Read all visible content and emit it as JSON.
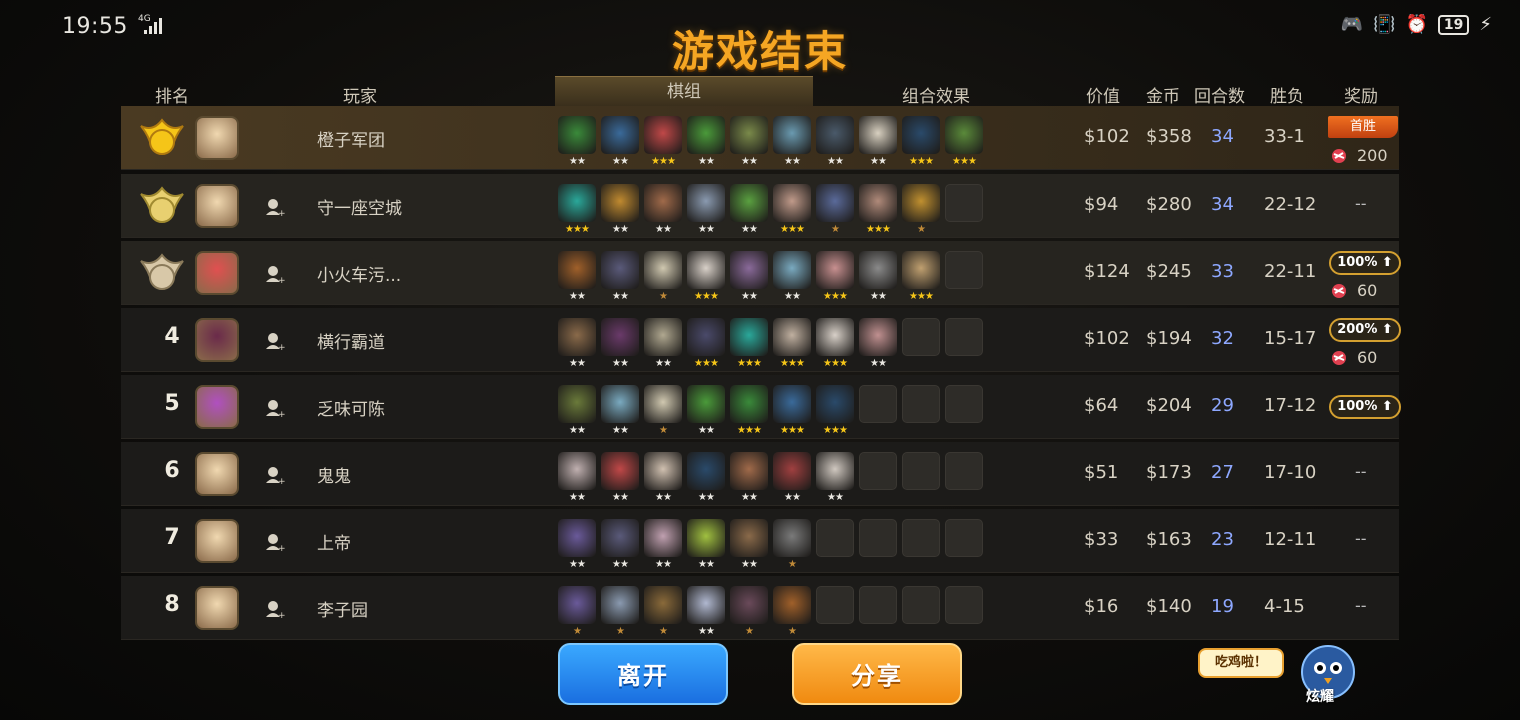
{
  "status_bar": {
    "time": "19:55",
    "network": "4G",
    "battery": "19"
  },
  "title": "游戏结束",
  "headers": {
    "rank": "排名",
    "player": "玩家",
    "lineup": "棋组",
    "synergy": "组合效果",
    "value": "价值",
    "gold": "金币",
    "rounds": "回合数",
    "winloss": "胜负",
    "reward": "奖励"
  },
  "rows": [
    {
      "rank": "1",
      "name": "橙子军团",
      "value": "$102",
      "gold": "$358",
      "rounds": "34",
      "winloss": "33-1",
      "reward_badge": "首胜",
      "reward_amount": "200",
      "units": [
        [
          "#3a8a3a",
          2
        ],
        [
          "#3a6a9a",
          2
        ],
        [
          "#c04848",
          3
        ],
        [
          "#4a9a3a",
          2
        ],
        [
          "#7a8a4a",
          2
        ],
        [
          "#6a9ab0",
          2
        ],
        [
          "#4a5a6a",
          2
        ],
        [
          "#d8d0c0",
          2
        ],
        [
          "#2a4a6a",
          3
        ],
        [
          "#5a8a3a",
          3
        ]
      ]
    },
    {
      "rank": "2",
      "name": "守一座空城",
      "value": "$94",
      "gold": "$280",
      "rounds": "34",
      "winloss": "22-12",
      "reward_text": "--",
      "units": [
        [
          "#2aa89a",
          3
        ],
        [
          "#c08a30",
          2
        ],
        [
          "#a06a4a",
          2
        ],
        [
          "#8a9ab0",
          2
        ],
        [
          "#5aa040",
          2
        ],
        [
          "#c09a8a",
          3
        ],
        [
          "#5a6a9a",
          1
        ],
        [
          "#b08a7a",
          3
        ],
        [
          "#c09030",
          1
        ],
        [
          null,
          0
        ]
      ]
    },
    {
      "rank": "3",
      "name": "小火车污...",
      "value": "$124",
      "gold": "$245",
      "rounds": "33",
      "winloss": "22-11",
      "reward_badge": "100%",
      "reward_amount": "60",
      "units": [
        [
          "#a0602a",
          2
        ],
        [
          "#5a5a7a",
          2
        ],
        [
          "#d0c8b0",
          1
        ],
        [
          "#d8d0c8",
          3
        ],
        [
          "#8a6a9a",
          2
        ],
        [
          "#7aaac0",
          2
        ],
        [
          "#c89090",
          3
        ],
        [
          "#8a8a8a",
          2
        ],
        [
          "#c0a070",
          3
        ],
        [
          null,
          0
        ]
      ]
    },
    {
      "rank": "4",
      "name": "横行霸道",
      "value": "$102",
      "gold": "$194",
      "rounds": "32",
      "winloss": "15-17",
      "reward_badge": "200%",
      "reward_amount": "60",
      "units": [
        [
          "#8a6a4a",
          2
        ],
        [
          "#6a3a6a",
          2
        ],
        [
          "#b0a890",
          2
        ],
        [
          "#4a4a6a",
          3
        ],
        [
          "#2aa89a",
          3
        ],
        [
          "#c0b0a0",
          3
        ],
        [
          "#d8d0c8",
          3
        ],
        [
          "#c09090",
          2
        ],
        [
          null,
          0
        ],
        [
          null,
          0
        ]
      ]
    },
    {
      "rank": "5",
      "name": "乏味可陈",
      "value": "$64",
      "gold": "$204",
      "rounds": "29",
      "winloss": "17-12",
      "reward_badge": "100%",
      "units": [
        [
          "#6a7a3a",
          2
        ],
        [
          "#7aaac0",
          2
        ],
        [
          "#d0c8b0",
          1
        ],
        [
          "#4a9a3a",
          2
        ],
        [
          "#3a8a3a",
          3
        ],
        [
          "#3a6a9a",
          3
        ],
        [
          "#2a4a6a",
          3
        ],
        [
          null,
          0
        ],
        [
          null,
          0
        ],
        [
          null,
          0
        ]
      ]
    },
    {
      "rank": "6",
      "name": "鬼鬼",
      "value": "$51",
      "gold": "$173",
      "rounds": "27",
      "winloss": "17-10",
      "reward_text": "--",
      "units": [
        [
          "#c0b0b0",
          2
        ],
        [
          "#c04848",
          2
        ],
        [
          "#d0c0b0",
          2
        ],
        [
          "#2a4a6a",
          2
        ],
        [
          "#a06a4a",
          2
        ],
        [
          "#a04040",
          2
        ],
        [
          "#d0c8c0",
          2
        ],
        [
          null,
          0
        ],
        [
          null,
          0
        ],
        [
          null,
          0
        ]
      ]
    },
    {
      "rank": "7",
      "name": "上帝",
      "value": "$33",
      "gold": "$163",
      "rounds": "23",
      "winloss": "12-11",
      "reward_text": "--",
      "units": [
        [
          "#6a5a9a",
          2
        ],
        [
          "#5a5a7a",
          2
        ],
        [
          "#c0a0b0",
          2
        ],
        [
          "#a0c040",
          2
        ],
        [
          "#8a6a4a",
          2
        ],
        [
          "#7a7a7a",
          1
        ],
        [
          null,
          0
        ],
        [
          null,
          0
        ],
        [
          null,
          0
        ],
        [
          null,
          0
        ]
      ]
    },
    {
      "rank": "8",
      "name": "李子园",
      "value": "$16",
      "gold": "$140",
      "rounds": "19",
      "winloss": "4-15",
      "reward_text": "--",
      "units": [
        [
          "#6a5a9a",
          1
        ],
        [
          "#8a9ab0",
          1
        ],
        [
          "#8a6a3a",
          1
        ],
        [
          "#b0b8d0",
          2
        ],
        [
          "#6a4a5a",
          1
        ],
        [
          "#a0602a",
          1
        ],
        [
          null,
          0
        ],
        [
          null,
          0
        ],
        [
          null,
          0
        ],
        [
          null,
          0
        ]
      ]
    }
  ],
  "buttons": {
    "leave": "离开",
    "share": "分享"
  },
  "bubble": "吃鸡啦！",
  "mascot_label": "炫耀"
}
